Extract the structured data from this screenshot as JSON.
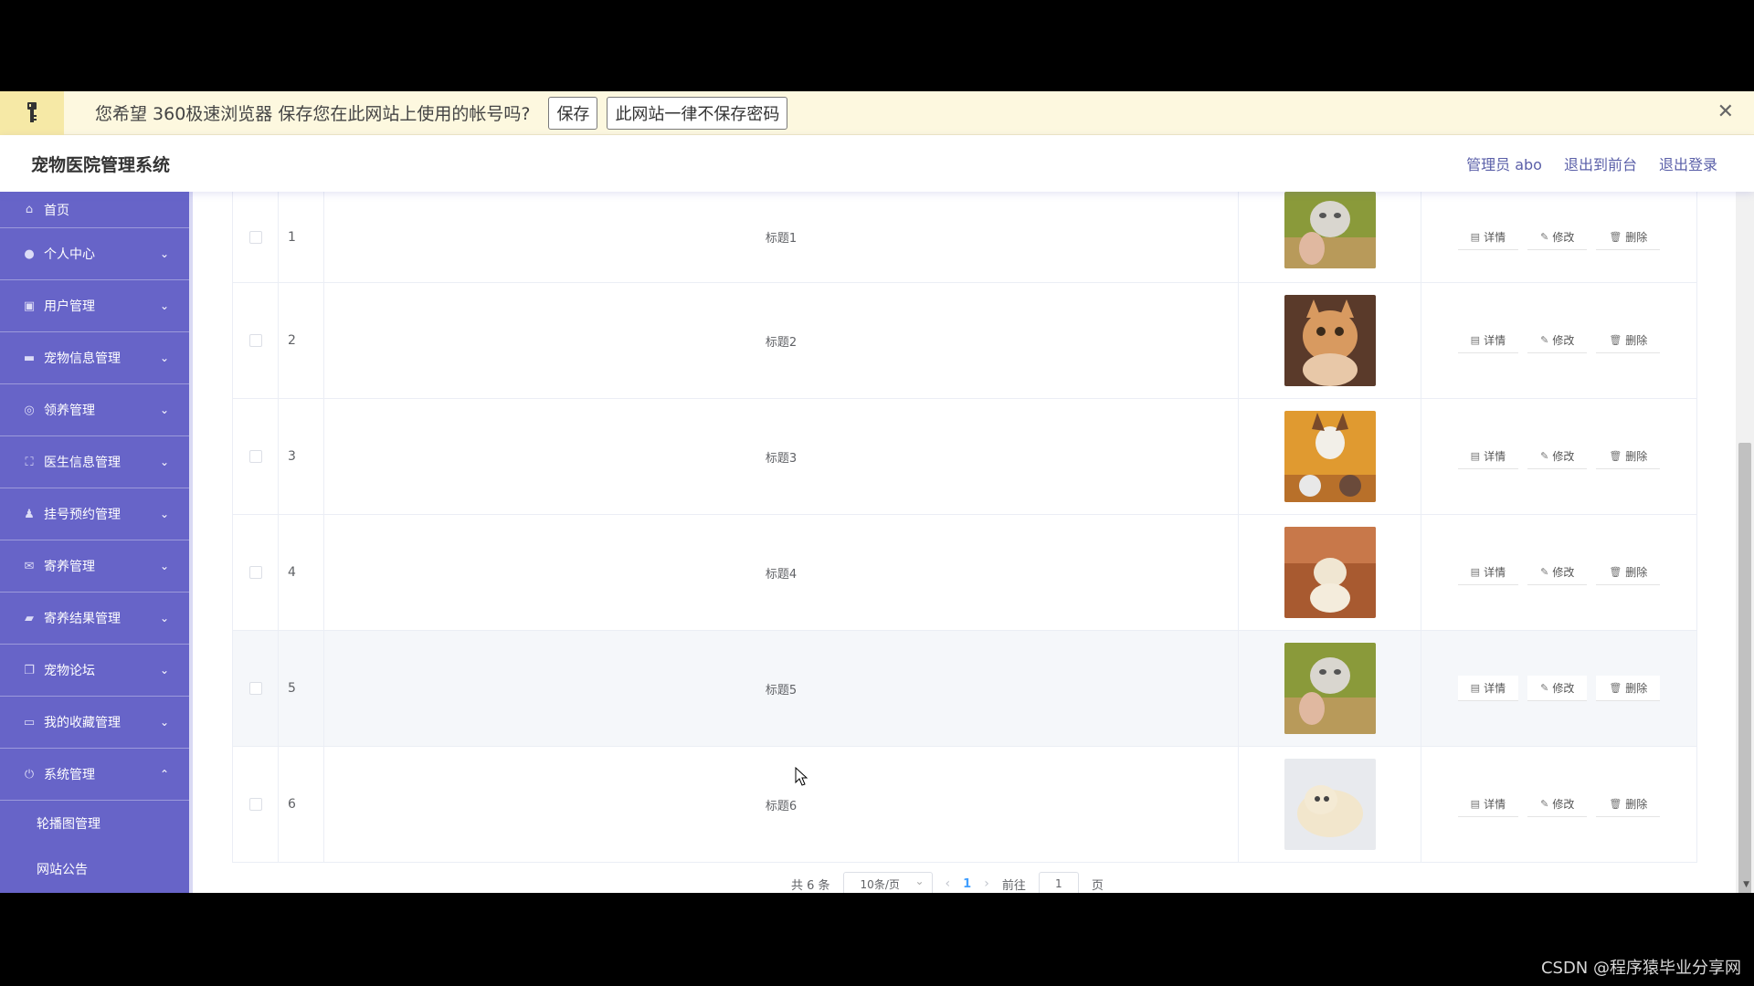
{
  "password_bar": {
    "message": "您希望 360极速浏览器 保存您在此网站上使用的帐号吗?",
    "save_label": "保存",
    "never_label": "此网站一律不保存密码",
    "close_symbol": "✕"
  },
  "header": {
    "title": "宠物医院管理系统",
    "user_label": "管理员 abo",
    "frontend_label": "退出到前台",
    "logout_label": "退出登录"
  },
  "sidebar": {
    "items": [
      {
        "label": "首页",
        "icon": "home-icon"
      },
      {
        "label": "个人中心",
        "icon": "user-icon"
      },
      {
        "label": "用户管理",
        "icon": "users-icon"
      },
      {
        "label": "宠物信息管理",
        "icon": "monitor-icon"
      },
      {
        "label": "领养管理",
        "icon": "globe-icon"
      },
      {
        "label": "医生信息管理",
        "icon": "frame-icon"
      },
      {
        "label": "挂号预约管理",
        "icon": "person-icon"
      },
      {
        "label": "寄养管理",
        "icon": "mail-icon"
      },
      {
        "label": "寄养结果管理",
        "icon": "chat-icon"
      },
      {
        "label": "宠物论坛",
        "icon": "copy-icon"
      },
      {
        "label": "我的收藏管理",
        "icon": "message-icon"
      },
      {
        "label": "系统管理",
        "icon": "power-icon"
      }
    ],
    "sub_items": [
      "轮播图管理",
      "网站公告"
    ]
  },
  "table": {
    "rows": [
      {
        "index": "1",
        "title": "标题1"
      },
      {
        "index": "2",
        "title": "标题2"
      },
      {
        "index": "3",
        "title": "标题3"
      },
      {
        "index": "4",
        "title": "标题4"
      },
      {
        "index": "5",
        "title": "标题5"
      },
      {
        "index": "6",
        "title": "标题6"
      }
    ],
    "actions": {
      "detail": "详情",
      "edit": "修改",
      "delete": "删除"
    }
  },
  "pagination": {
    "total": "共 6 条",
    "page_size": "10条/页",
    "current_page": "1",
    "goto_prefix": "前往",
    "goto_value": "1",
    "goto_suffix": "页"
  },
  "watermark": "CSDN @程序猿毕业分享网",
  "colors": {
    "sidebar": "#6764c8",
    "accent": "#409eff",
    "header_link": "#5a5fa8"
  }
}
